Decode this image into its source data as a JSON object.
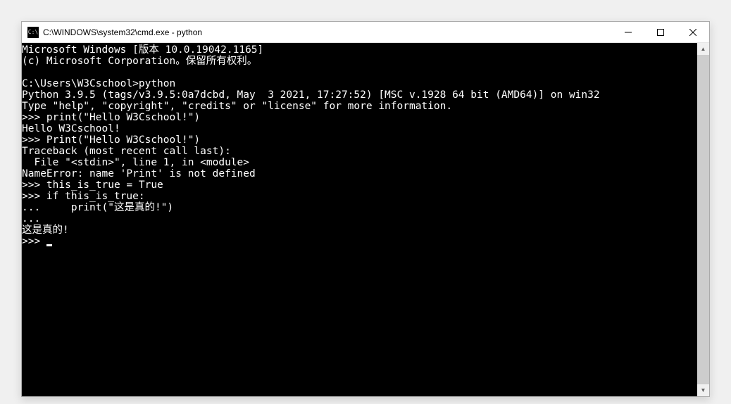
{
  "window": {
    "title": "C:\\WINDOWS\\system32\\cmd.exe - python"
  },
  "terminal": {
    "lines": [
      "Microsoft Windows [版本 10.0.19042.1165]",
      "(c) Microsoft Corporation。保留所有权利。",
      "",
      "C:\\Users\\W3Cschool>python",
      "Python 3.9.5 (tags/v3.9.5:0a7dcbd, May  3 2021, 17:27:52) [MSC v.1928 64 bit (AMD64)] on win32",
      "Type \"help\", \"copyright\", \"credits\" or \"license\" for more information.",
      ">>> print(\"Hello W3Cschool!\")",
      "Hello W3Cschool!",
      ">>> Print(\"Hello W3Cschool!\")",
      "Traceback (most recent call last):",
      "  File \"<stdin>\", line 1, in <module>",
      "NameError: name 'Print' is not defined",
      ">>> this_is_true = True",
      ">>> if this_is_true:",
      "...     print(\"这是真的!\")",
      "...",
      "这是真的!",
      ">>> "
    ]
  }
}
